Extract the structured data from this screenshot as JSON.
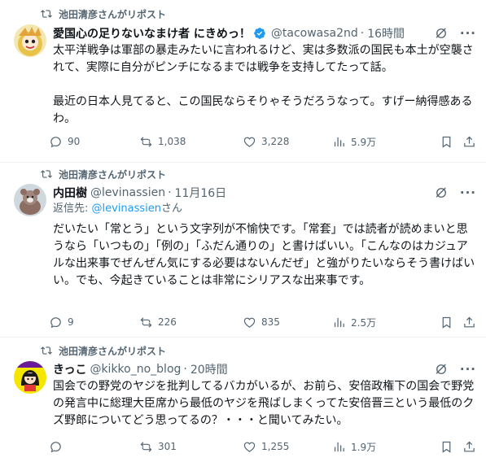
{
  "tweets": [
    {
      "repost_label": "池田清彦さんがリポスト",
      "name": "愛国心の足りないなまけ者 にきめっ！",
      "verified": true,
      "handle": "@tacowasa2nd",
      "dot": "·",
      "time": "16時間",
      "reply_to_prefix": "",
      "reply_to_handle": "",
      "reply_to_suffix": "",
      "text": "太平洋戦争は軍部の暴走みたいに言われるけど、実は多数派の国民も本土が空襲されて、実際に自分がピンチになるまでは戦争を支持してたって話。\n\n最近の日本人見てると、この国民ならそりゃそうだろうなって。すげー納得感あるわ。",
      "replies": "90",
      "reposts": "1,038",
      "likes": "3,228",
      "views": "5.9万"
    },
    {
      "repost_label": "池田清彦さんがリポスト",
      "name": "内田樹",
      "verified": false,
      "handle": "@levinassien",
      "dot": "·",
      "time": "11月16日",
      "reply_to_prefix": "返信先: ",
      "reply_to_handle": "@levinassien",
      "reply_to_suffix": "さん",
      "text": "だいたい「常とう」という文字列が不愉快です。「常套」では読者が読めまいと思うなら「いつもの」「例の」「ふだん通りの」と書けばいい。「こんなのはカジュアルな出来事でぜんぜん気にする必要はないんだぜ」と強がりたいならそう書けばいい。でも、今起きていることは非常にシリアスな出来事です。",
      "replies": "9",
      "reposts": "226",
      "likes": "835",
      "views": "2.5万"
    },
    {
      "repost_label": "池田清彦さんがリポスト",
      "name": "きっこ",
      "verified": false,
      "handle": "@kikko_no_blog",
      "dot": "·",
      "time": "20時間",
      "reply_to_prefix": "",
      "reply_to_handle": "",
      "reply_to_suffix": "",
      "text": "国会での野党のヤジを批判してるバカがいるが、お前ら、安倍政権下の国会で野党の発言中に総理大臣席から最低のヤジを飛ばしまくってた安倍晋三という最低のクズ野郎についてどう思ってるの？・・・と聞いてみたい。",
      "replies": "",
      "reposts": "301",
      "likes": "1,255",
      "views": "1.9万"
    }
  ],
  "colors": {
    "text": "#0f1419",
    "secondary": "#536471",
    "link": "#1d9bf0",
    "verified": "#1d9bf0",
    "divider": "#eff3f4"
  },
  "icons": {
    "repost": "repost-icon",
    "grok": "grok-icon",
    "more": "more-icon",
    "reply": "reply-icon",
    "like": "heart-icon",
    "views": "views-icon",
    "bookmark": "bookmark-icon",
    "share": "share-icon"
  }
}
